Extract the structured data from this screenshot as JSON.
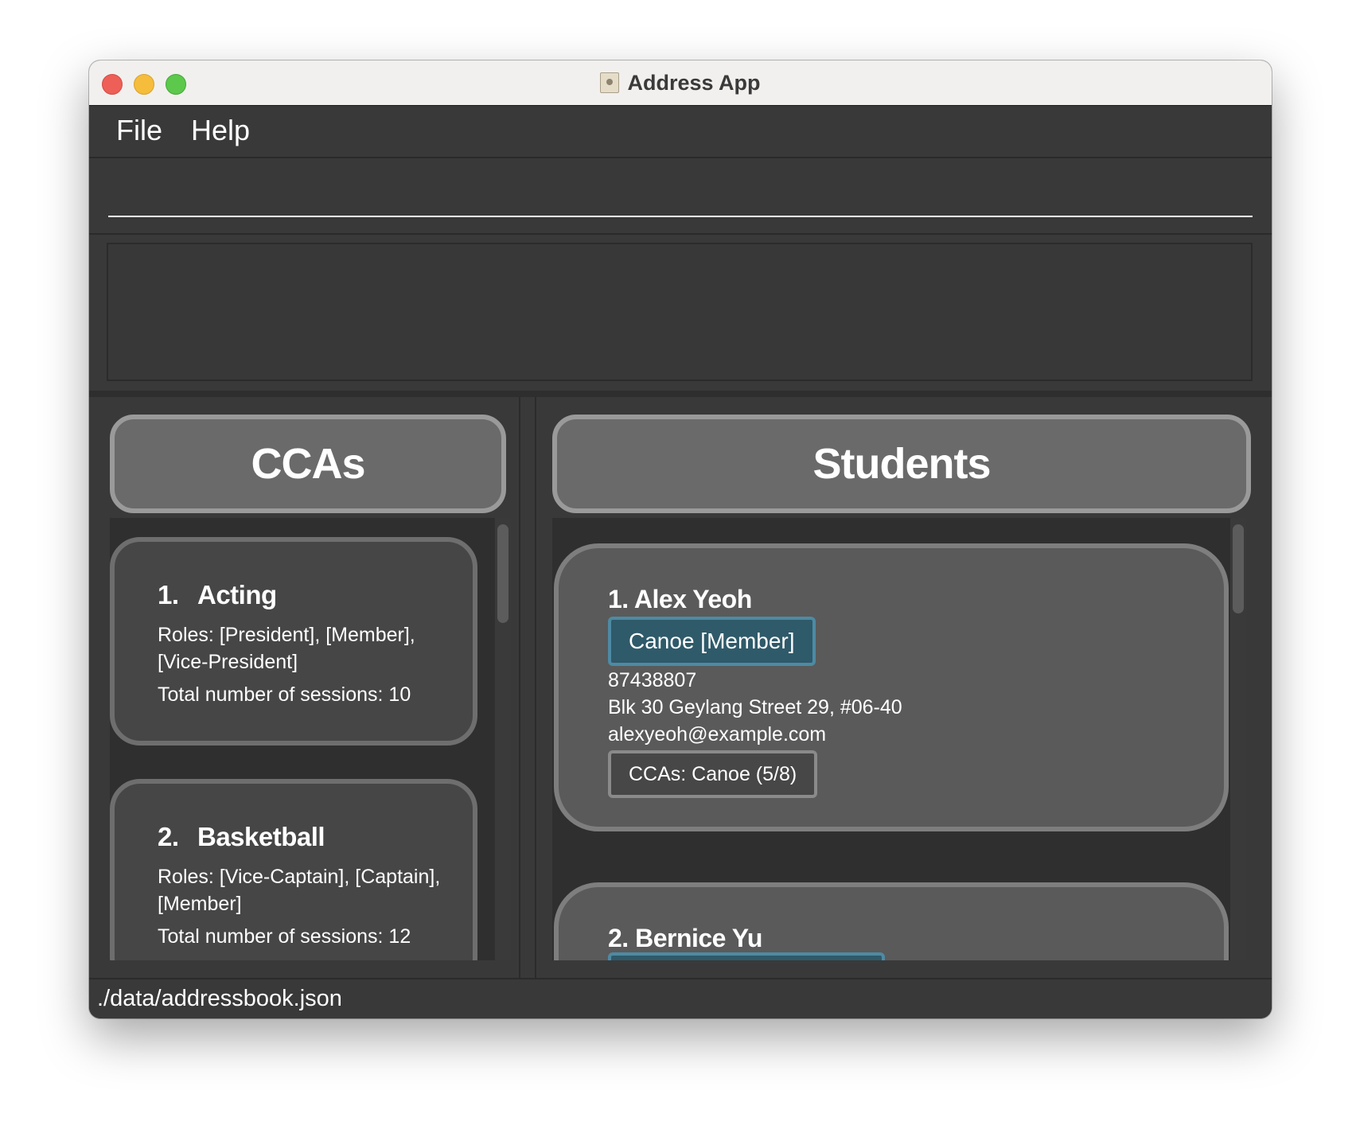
{
  "window": {
    "title": "Address App"
  },
  "menu": {
    "file": "File",
    "help": "Help"
  },
  "command": {
    "value": "",
    "placeholder": ""
  },
  "result": {
    "text": ""
  },
  "ccas": {
    "header": "CCAs",
    "items": [
      {
        "index": "1.",
        "name": "Acting",
        "roles": "Roles: [President], [Member], [Vice-President]",
        "sessions": "Total number of sessions: 10"
      },
      {
        "index": "2.",
        "name": "Basketball",
        "roles": "Roles: [Vice-Captain], [Captain], [Member]",
        "sessions": "Total number of sessions: 12"
      }
    ]
  },
  "students": {
    "header": "Students",
    "items": [
      {
        "name": "1. Alex Yeoh",
        "role_tag": "Canoe [Member]",
        "phone": "87438807",
        "address": "Blk 30 Geylang Street 29, #06-40",
        "email": "alexyeoh@example.com",
        "cca_tag": "CCAs: Canoe (5/8)"
      },
      {
        "name": "2. Bernice Yu"
      }
    ]
  },
  "status": {
    "path": "./data/addressbook.json"
  },
  "colors": {
    "background": "#393939",
    "role_tag": "#2f5a6a",
    "role_tag_border": "#4e8aa3",
    "header": "#6a6a6a"
  }
}
